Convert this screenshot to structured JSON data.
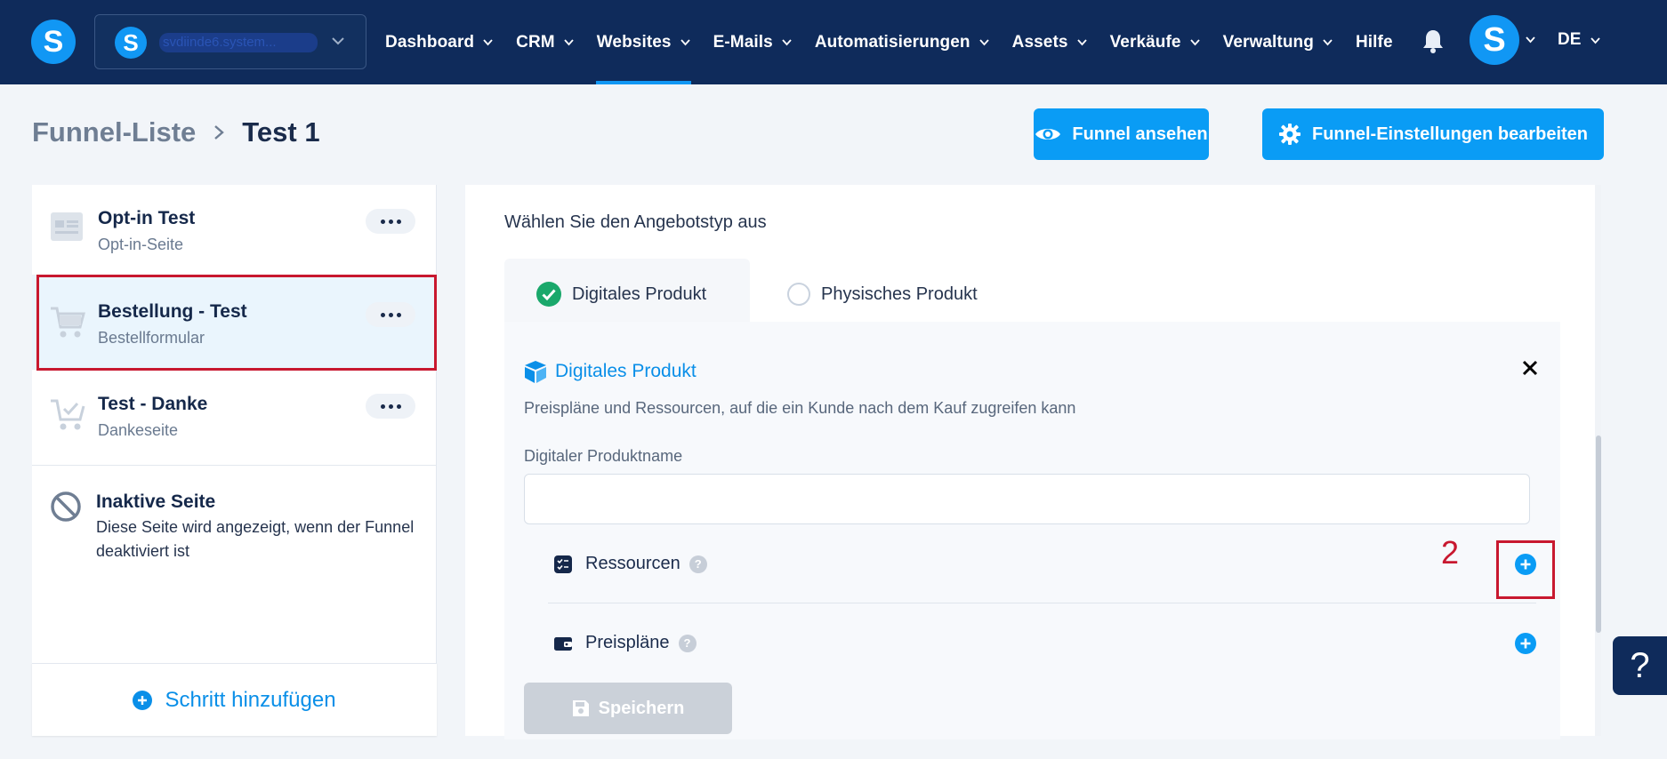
{
  "nav": {
    "logo_letter": "S",
    "account_letter": "S",
    "account_name": "svdiinde6.system...",
    "items": [
      {
        "label": "Dashboard"
      },
      {
        "label": "CRM"
      },
      {
        "label": "Websites"
      },
      {
        "label": "E-Mails"
      },
      {
        "label": "Automatisierungen"
      },
      {
        "label": "Assets"
      },
      {
        "label": "Verkäufe"
      },
      {
        "label": "Verwaltung"
      }
    ],
    "help_label": "Hilfe",
    "user_letter": "S",
    "language": "DE"
  },
  "breadcrumb": {
    "root": "Funnel-Liste",
    "current": "Test 1"
  },
  "header_buttons": {
    "view_label": "Funnel ansehen",
    "settings_label": "Funnel-Einstellungen bearbeiten"
  },
  "steps": [
    {
      "title": "Opt-in Test",
      "subtitle": "Opt-in-Seite",
      "icon": "optin-page-icon"
    },
    {
      "title": "Bestellung - Test",
      "subtitle": "Bestellformular",
      "icon": "cart-icon"
    },
    {
      "title": "Test - Danke",
      "subtitle": "Dankeseite",
      "icon": "cart-check-icon"
    }
  ],
  "inactive": {
    "title": "Inaktive Seite",
    "description": "Diese Seite wird angezeigt, wenn der Funnel deaktiviert ist"
  },
  "add_step_label": "Schritt hinzufügen",
  "offer": {
    "label": "Wählen Sie den Angebotstyp aus",
    "tabs": [
      {
        "label": "Digitales Produkt",
        "selected": true
      },
      {
        "label": "Physisches Produkt",
        "selected": false
      }
    ]
  },
  "digital_product": {
    "title": "Digitales Produkt",
    "description": "Preispläne und Ressourcen, auf die ein Kunde nach dem Kauf zugreifen kann",
    "name_label": "Digitaler Produktname",
    "name_value": "",
    "resources_label": "Ressourcen",
    "price_plans_label": "Preispläne",
    "help_glyph": "?"
  },
  "save_label": "Speichern",
  "annotation_number": "2",
  "help_fab_glyph": "?",
  "colors": {
    "nav_bg": "#0f2b5b",
    "accent": "#0a9cf5",
    "annotation": "#c8182f",
    "selected_step_bg": "#eaf5fd",
    "success": "#1aa86b"
  }
}
